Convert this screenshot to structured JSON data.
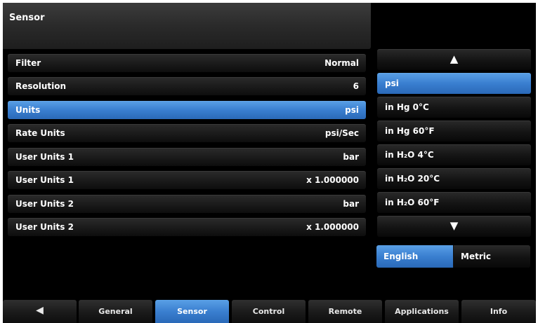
{
  "header": {
    "title": "Sensor"
  },
  "settings": {
    "rows": [
      {
        "label": "Filter",
        "value": "Normal"
      },
      {
        "label": "Resolution",
        "value": "6"
      },
      {
        "label": "Units",
        "value": "psi"
      },
      {
        "label": "Rate Units",
        "value": "psi/Sec"
      },
      {
        "label": "User Units 1",
        "value": "bar"
      },
      {
        "label": "User Units 1",
        "value": "x 1.000000"
      },
      {
        "label": "User Units 2",
        "value": "bar"
      },
      {
        "label": "User Units 2",
        "value": "x 1.000000"
      }
    ],
    "selected_label": "Units"
  },
  "picker": {
    "up_glyph": "▲",
    "down_glyph": "▼",
    "options": [
      "psi",
      "in Hg 0°C",
      "in Hg 60°F",
      "in H₂O 4°C",
      "in H₂O 20°C",
      "in H₂O 60°F"
    ],
    "selected": "psi"
  },
  "unit_system": {
    "english": "English",
    "metric": "Metric",
    "selected": "English"
  },
  "tabs": {
    "back_glyph": "◀",
    "items": [
      "General",
      "Sensor",
      "Control",
      "Remote",
      "Applications",
      "Info"
    ],
    "active": "Sensor"
  },
  "colors": {
    "accent": "#3a7fd0",
    "background": "#000000",
    "text": "#ffffff"
  }
}
